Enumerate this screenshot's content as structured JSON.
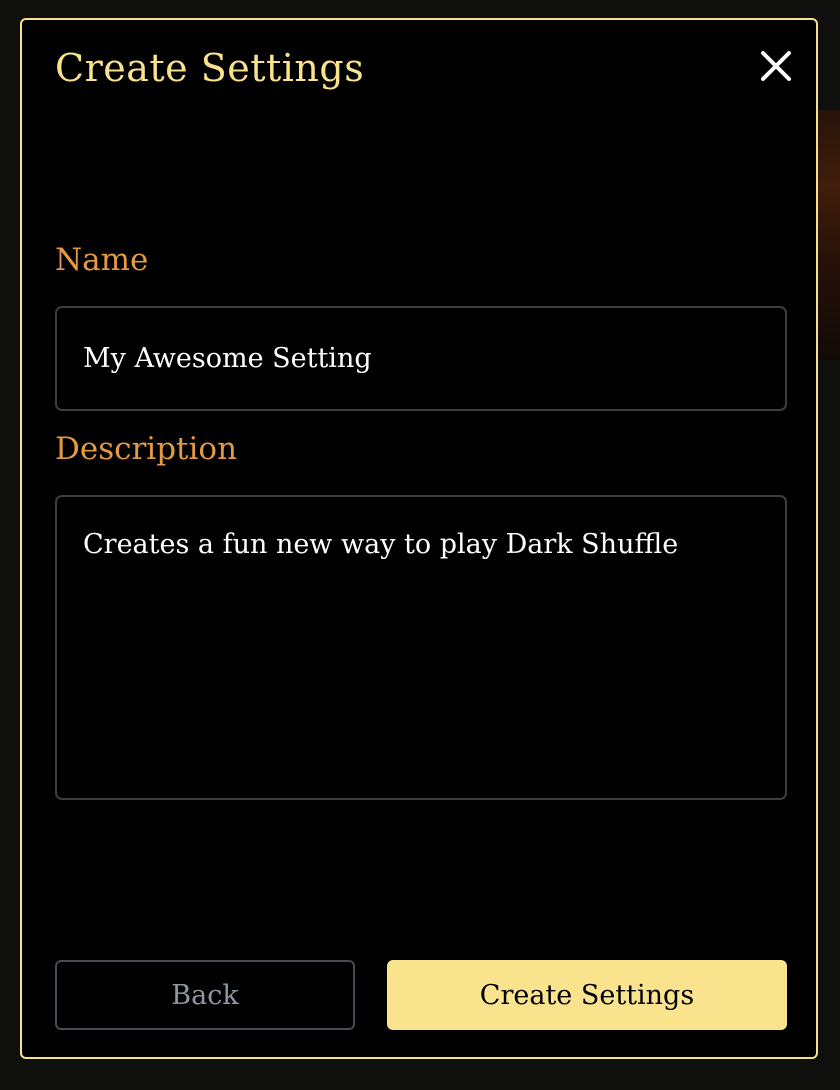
{
  "dialog": {
    "title": "Create Settings",
    "close_icon": "close-icon"
  },
  "form": {
    "name_label": "Name",
    "name_value": "My Awesome Setting",
    "description_label": "Description",
    "description_value": "Creates a fun new way to play Dark Shuffle"
  },
  "actions": {
    "back_label": "Back",
    "create_label": "Create Settings"
  },
  "colors": {
    "accent": "#f8e28c",
    "label": "#e49a45",
    "background": "#000000"
  }
}
